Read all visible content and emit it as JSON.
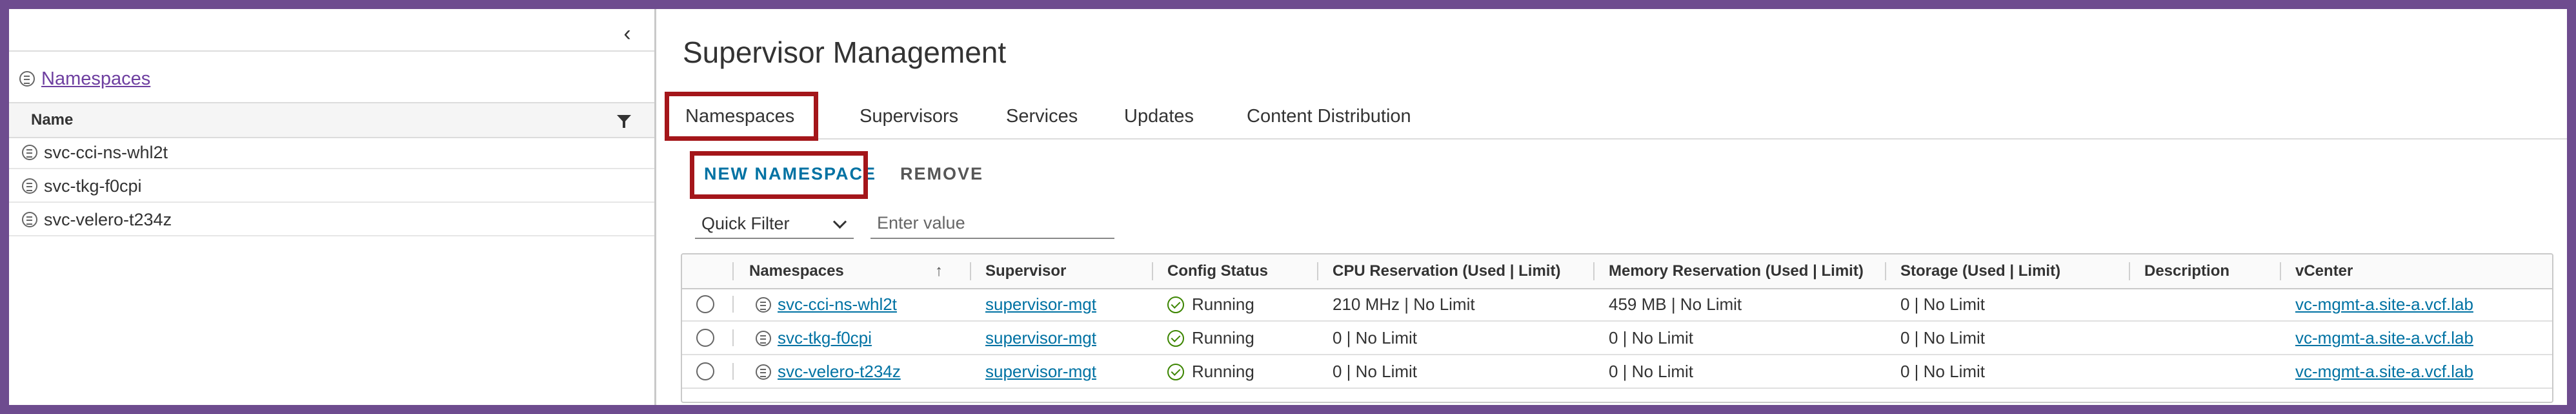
{
  "colors": {
    "border_purple": "#6e4c8f",
    "highlight_red": "#a4161a",
    "link_blue": "#0072a3",
    "ok_green": "#3c8500",
    "nav_link_purple": "#6e3fa0"
  },
  "left_panel": {
    "collapse_icon": "chevron-left-icon",
    "namespaces_link": "Namespaces",
    "column_header": "Name",
    "filter_icon": "filter-icon",
    "items": [
      "svc-cci-ns-whl2t",
      "svc-tkg-f0cpi",
      "svc-velero-t234z"
    ]
  },
  "main": {
    "title": "Supervisor Management",
    "tabs": [
      "Namespaces",
      "Supervisors",
      "Services",
      "Updates",
      "Content Distribution"
    ],
    "active_tab": "Namespaces",
    "actions": {
      "new_namespace": "NEW NAMESPACE",
      "remove": "REMOVE"
    },
    "filter": {
      "quick_filter": "Quick Filter",
      "placeholder": "Enter value"
    },
    "grid": {
      "columns": [
        "Namespaces",
        "Supervisor",
        "Config Status",
        "CPU Reservation (Used | Limit)",
        "Memory Reservation (Used | Limit)",
        "Storage (Used | Limit)",
        "Description",
        "vCenter"
      ],
      "sort_icon": "arrow-up-icon",
      "rows": [
        {
          "namespace": "svc-cci-ns-whl2t",
          "supervisor": "supervisor-mgt",
          "status": "Running",
          "cpu": "210 MHz | No Limit",
          "memory": "459 MB | No Limit",
          "storage": "0 | No Limit",
          "description": "",
          "vcenter": "vc-mgmt-a.site-a.vcf.lab"
        },
        {
          "namespace": "svc-tkg-f0cpi",
          "supervisor": "supervisor-mgt",
          "status": "Running",
          "cpu": "0 | No Limit",
          "memory": "0 | No Limit",
          "storage": "0 | No Limit",
          "description": "",
          "vcenter": "vc-mgmt-a.site-a.vcf.lab"
        },
        {
          "namespace": "svc-velero-t234z",
          "supervisor": "supervisor-mgt",
          "status": "Running",
          "cpu": "0 | No Limit",
          "memory": "0 | No Limit",
          "storage": "0 | No Limit",
          "description": "",
          "vcenter": "vc-mgmt-a.site-a.vcf.lab"
        }
      ]
    }
  }
}
